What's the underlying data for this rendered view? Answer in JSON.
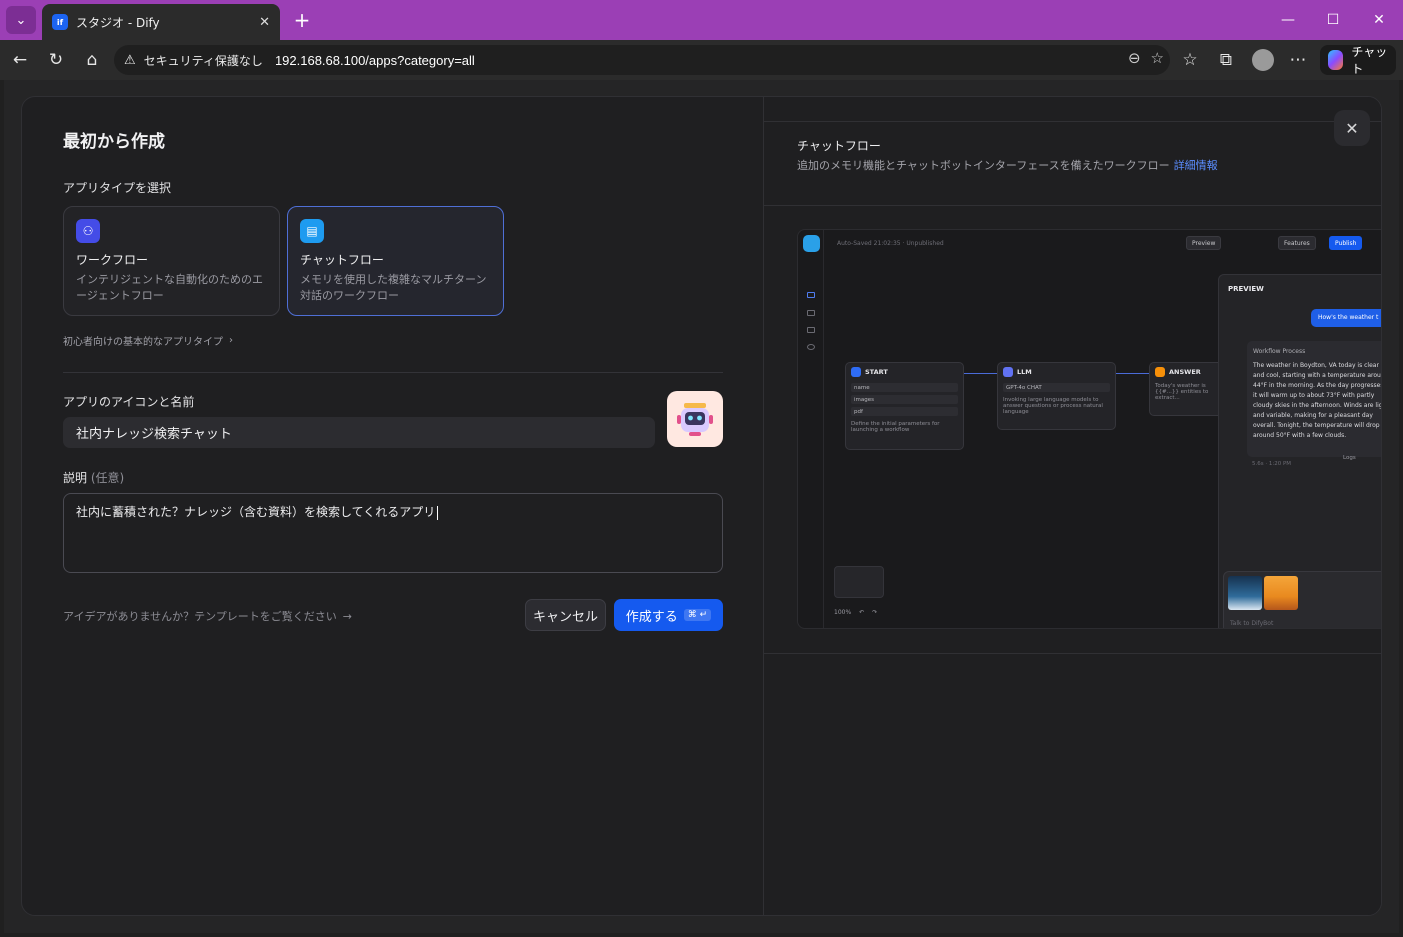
{
  "browser": {
    "tab_title": "スタジオ - Dify",
    "tab_favicon": "dify-icon",
    "security_label": "セキュリティ保護なし",
    "url": "192.168.68.100/apps?category=all",
    "copilot_label": "チャット"
  },
  "form": {
    "title": "最初から作成",
    "app_type_label": "アプリタイプを選択",
    "types": [
      {
        "title": "ワークフロー",
        "desc": "インテリジェントな自動化のためのエージェントフロー",
        "icon": "workflow-icon",
        "color": "#444ce7"
      },
      {
        "title": "チャットフロー",
        "desc": "メモリを使用した複雑なマルチターン対話のワークフロー",
        "icon": "chatflow-icon",
        "color": "#1e9bf0",
        "selected": true
      }
    ],
    "beginner_link": "初心者向けの基本的なアプリタイプ",
    "name_label": "アプリのアイコンと名前",
    "name_value": "社内ナレッジ検索チャット",
    "desc_label": "説明",
    "desc_optional": "(任意)",
    "desc_value": "社内に蓄積された？ナレッジ（含む資料）を検索してくれるアプリ",
    "idea_link": "アイデアがありませんか？テンプレートをご覧ください",
    "cancel_label": "キャンセル",
    "create_label": "作成する",
    "create_shortcut": "⌘ ↵"
  },
  "detail": {
    "title": "チャットフロー",
    "desc": "追加のメモリ機能とチャットボットインターフェースを備えたワークフロー",
    "link": "詳細情報"
  },
  "preview": {
    "autosave": "Auto-Saved 21:02:35 · Unpublished",
    "btn_preview": "Preview",
    "btn_features": "Features",
    "btn_publish": "Publish",
    "nodes": {
      "start": {
        "title": "START",
        "vars": [
          "name",
          "images",
          "pdf"
        ],
        "required": "REQUIRED",
        "desc": "Define the initial parameters for launching a workflow"
      },
      "llm": {
        "title": "LLM",
        "model": "GPT-4o",
        "mode": "CHAT",
        "desc": "Invoking large language models to answer questions or process natural language"
      },
      "answer": {
        "title": "ANSWER",
        "label": "ANSWER",
        "text": "Today's weather is {{#...}} entities to extract..."
      }
    },
    "panel": {
      "title": "PREVIEW",
      "question": "How's the weather t",
      "workflow_process": "Workflow Process",
      "answer": "The weather in Boydton, VA today is clear and cool, starting with a temperature around 44°F in the morning. As the day progresses, it will warm up to about 73°F with partly cloudy skies in the afternoon. Winds are light and variable, making for a pleasant day overall. Tonight, the temperature will drop to around 50°F with a few clouds.",
      "meta": "5.6s · 1:20 PM",
      "logs": "Logs",
      "placeholder": "Talk to DifyBot"
    },
    "zoom": "100%"
  }
}
